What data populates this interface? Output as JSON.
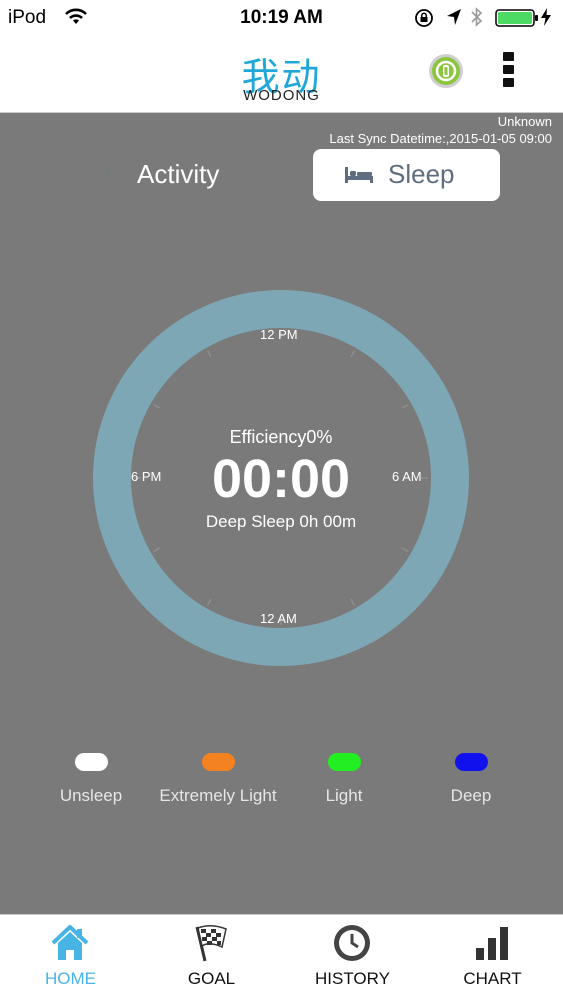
{
  "status_bar": {
    "carrier": "iPod",
    "time": "10:19 AM"
  },
  "header": {
    "logo_cn": "我动",
    "logo_en": "WODONG",
    "device_icon": "device-badge-icon",
    "menu_icon": "more-vertical-icon"
  },
  "sync": {
    "device": "Unknown",
    "last_sync": "Last Sync Datetime:,2015-01-05 09:00"
  },
  "mode_tabs": {
    "activity": "Activity",
    "sleep": "Sleep",
    "selected": "Sleep"
  },
  "dial": {
    "efficiency": "Efficiency0%",
    "duration": "00:00",
    "deep_sleep": "Deep Sleep 0h 00m",
    "hour_labels": {
      "top": "12 PM",
      "right": "6 AM",
      "bottom": "12 AM",
      "left": "6 PM"
    },
    "ring_color": "#7ea7b5"
  },
  "legend": [
    {
      "label": "Unsleep",
      "color": "#ffffff"
    },
    {
      "label": "Extremely Light",
      "color": "#f58220"
    },
    {
      "label": "Light",
      "color": "#22ee22"
    },
    {
      "label": "Deep",
      "color": "#1111ee"
    }
  ],
  "tabbar": [
    {
      "label": "HOME",
      "icon": "home-icon",
      "active": true
    },
    {
      "label": "GOAL",
      "icon": "checkered-flag-icon",
      "active": false
    },
    {
      "label": "HISTORY",
      "icon": "history-clock-icon",
      "active": false
    },
    {
      "label": "CHART",
      "icon": "bar-chart-icon",
      "active": false
    }
  ],
  "colors": {
    "accent": "#48b4e6",
    "background": "#7a7a7a"
  }
}
